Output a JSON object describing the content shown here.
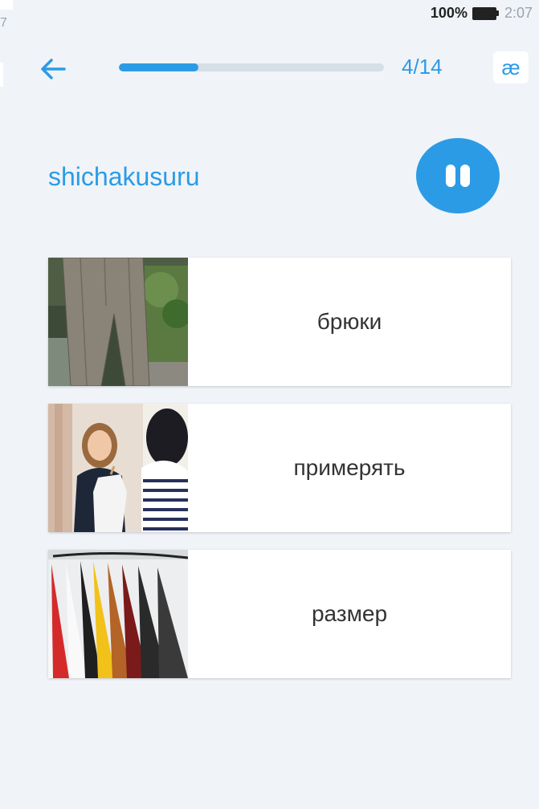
{
  "status_bar": {
    "left_fragment": "7",
    "battery_percent": "100%",
    "time": "2:07"
  },
  "header": {
    "progress_fraction": 0.3,
    "progress_text": "4/14",
    "ae_button_label": "æ"
  },
  "prompt": {
    "word": "shichakusuru",
    "audio_state": "playing"
  },
  "options": [
    {
      "label": "брюки",
      "image": "photo-trousers"
    },
    {
      "label": "примерять",
      "image": "photo-trying-on"
    },
    {
      "label": "размер",
      "image": "photo-clothes-rack"
    }
  ],
  "colors": {
    "accent": "#2c9be6",
    "background": "#f0f4f8",
    "track": "#d6dee6"
  }
}
